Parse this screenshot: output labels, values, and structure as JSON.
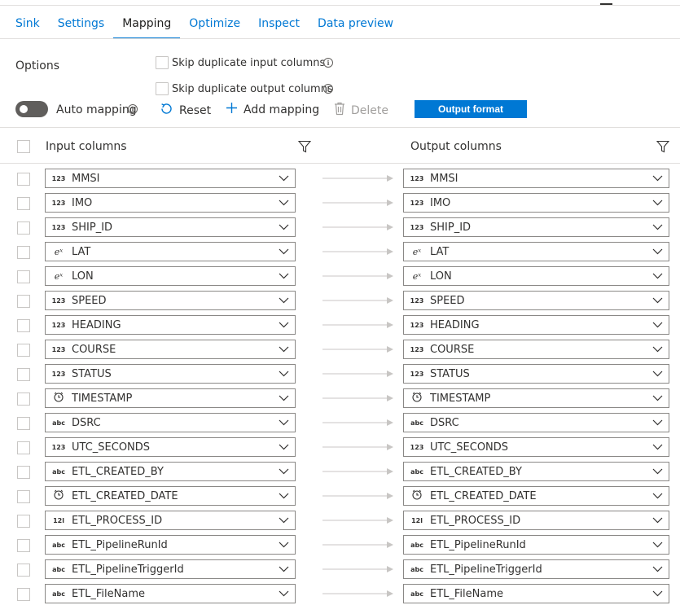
{
  "tabs": [
    {
      "label": "Sink",
      "active": false
    },
    {
      "label": "Settings",
      "active": false
    },
    {
      "label": "Mapping",
      "active": true
    },
    {
      "label": "Optimize",
      "active": false
    },
    {
      "label": "Inspect",
      "active": false
    },
    {
      "label": "Data preview",
      "active": false
    }
  ],
  "options": {
    "label": "Options",
    "skip_input_label": "Skip duplicate input columns",
    "skip_output_label": "Skip duplicate output columns",
    "info_glyph": "i"
  },
  "toolbar": {
    "auto_mapping_label": "Auto mapping",
    "auto_mapping_on": false,
    "reset_label": "Reset",
    "add_mapping_label": "Add mapping",
    "delete_label": "Delete",
    "output_format_label": "Output format"
  },
  "grid": {
    "input_header": "Input columns",
    "output_header": "Output columns",
    "rows": [
      {
        "type": "123",
        "input": "MMSI",
        "output": "MMSI"
      },
      {
        "type": "123",
        "input": "IMO",
        "output": "IMO"
      },
      {
        "type": "123",
        "input": "SHIP_ID",
        "output": "SHIP_ID"
      },
      {
        "type": "eˣ",
        "input": "LAT",
        "output": "LAT"
      },
      {
        "type": "eˣ",
        "input": "LON",
        "output": "LON"
      },
      {
        "type": "123",
        "input": "SPEED",
        "output": "SPEED"
      },
      {
        "type": "123",
        "input": "HEADING",
        "output": "HEADING"
      },
      {
        "type": "123",
        "input": "COURSE",
        "output": "COURSE"
      },
      {
        "type": "123",
        "input": "STATUS",
        "output": "STATUS"
      },
      {
        "type": "datetime",
        "input": "TIMESTAMP",
        "output": "TIMESTAMP"
      },
      {
        "type": "abc",
        "input": "DSRC",
        "output": "DSRC"
      },
      {
        "type": "123",
        "input": "UTC_SECONDS",
        "output": "UTC_SECONDS"
      },
      {
        "type": "abc",
        "input": "ETL_CREATED_BY",
        "output": "ETL_CREATED_BY"
      },
      {
        "type": "datetime",
        "input": "ETL_CREATED_DATE",
        "output": "ETL_CREATED_DATE"
      },
      {
        "type": "12l",
        "input": "ETL_PROCESS_ID",
        "output": "ETL_PROCESS_ID"
      },
      {
        "type": "abc",
        "input": "ETL_PipelineRunId",
        "output": "ETL_PipelineRunId"
      },
      {
        "type": "abc",
        "input": "ETL_PipelineTriggerId",
        "output": "ETL_PipelineTriggerId"
      },
      {
        "type": "abc",
        "input": "ETL_FileName",
        "output": "ETL_FileName"
      }
    ]
  },
  "colors": {
    "accent": "#0078d4",
    "toggle_off": "#605e5c",
    "arrow": "#c8c6c4"
  }
}
